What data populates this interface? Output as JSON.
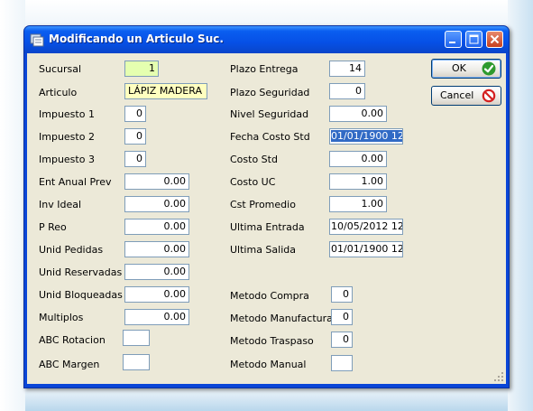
{
  "window": {
    "title": "Modificando un Articulo Suc."
  },
  "buttons": {
    "ok": "OK",
    "cancel": "Cancel"
  },
  "left_fields": [
    {
      "label": "Sucursal",
      "value": "1"
    },
    {
      "label": "Articulo",
      "value": "LÁPIZ MADERA"
    },
    {
      "label": "Impuesto 1",
      "value": "0"
    },
    {
      "label": "Impuesto 2",
      "value": "0"
    },
    {
      "label": "Impuesto 3",
      "value": "0"
    },
    {
      "label": "Ent Anual Prev",
      "value": "0.00"
    },
    {
      "label": "Inv Ideal",
      "value": "0.00"
    },
    {
      "label": "P Reo",
      "value": "0.00"
    },
    {
      "label": "Unid Pedidas",
      "value": "0.00"
    },
    {
      "label": "Unid Reservadas",
      "value": "0.00"
    },
    {
      "label": "Unid Bloqueadas",
      "value": "0.00"
    },
    {
      "label": "Multiplos",
      "value": "0.00"
    },
    {
      "label": "ABC Rotacion",
      "value": ""
    },
    {
      "label": "ABC Margen",
      "value": ""
    }
  ],
  "right_fields": [
    {
      "label": "Plazo Entrega",
      "value": "14"
    },
    {
      "label": "Plazo Seguridad",
      "value": "0"
    },
    {
      "label": "Nivel Seguridad",
      "value": "0.00"
    },
    {
      "label": "Fecha Costo Std",
      "value": "01/01/1900 12:"
    },
    {
      "label": "Costo Std",
      "value": "0.00"
    },
    {
      "label": "Costo UC",
      "value": "1.00"
    },
    {
      "label": "Cst Promedio",
      "value": "1.00"
    },
    {
      "label": "Ultima Entrada",
      "value": "10/05/2012 12:"
    },
    {
      "label": "Ultima Salida",
      "value": "01/01/1900 12:"
    },
    {
      "label": "Metodo Compra",
      "value": "0"
    },
    {
      "label": "Metodo Manufactura",
      "value": "0"
    },
    {
      "label": "Metodo Traspaso",
      "value": "0"
    },
    {
      "label": "Metodo Manual",
      "value": ""
    }
  ]
}
